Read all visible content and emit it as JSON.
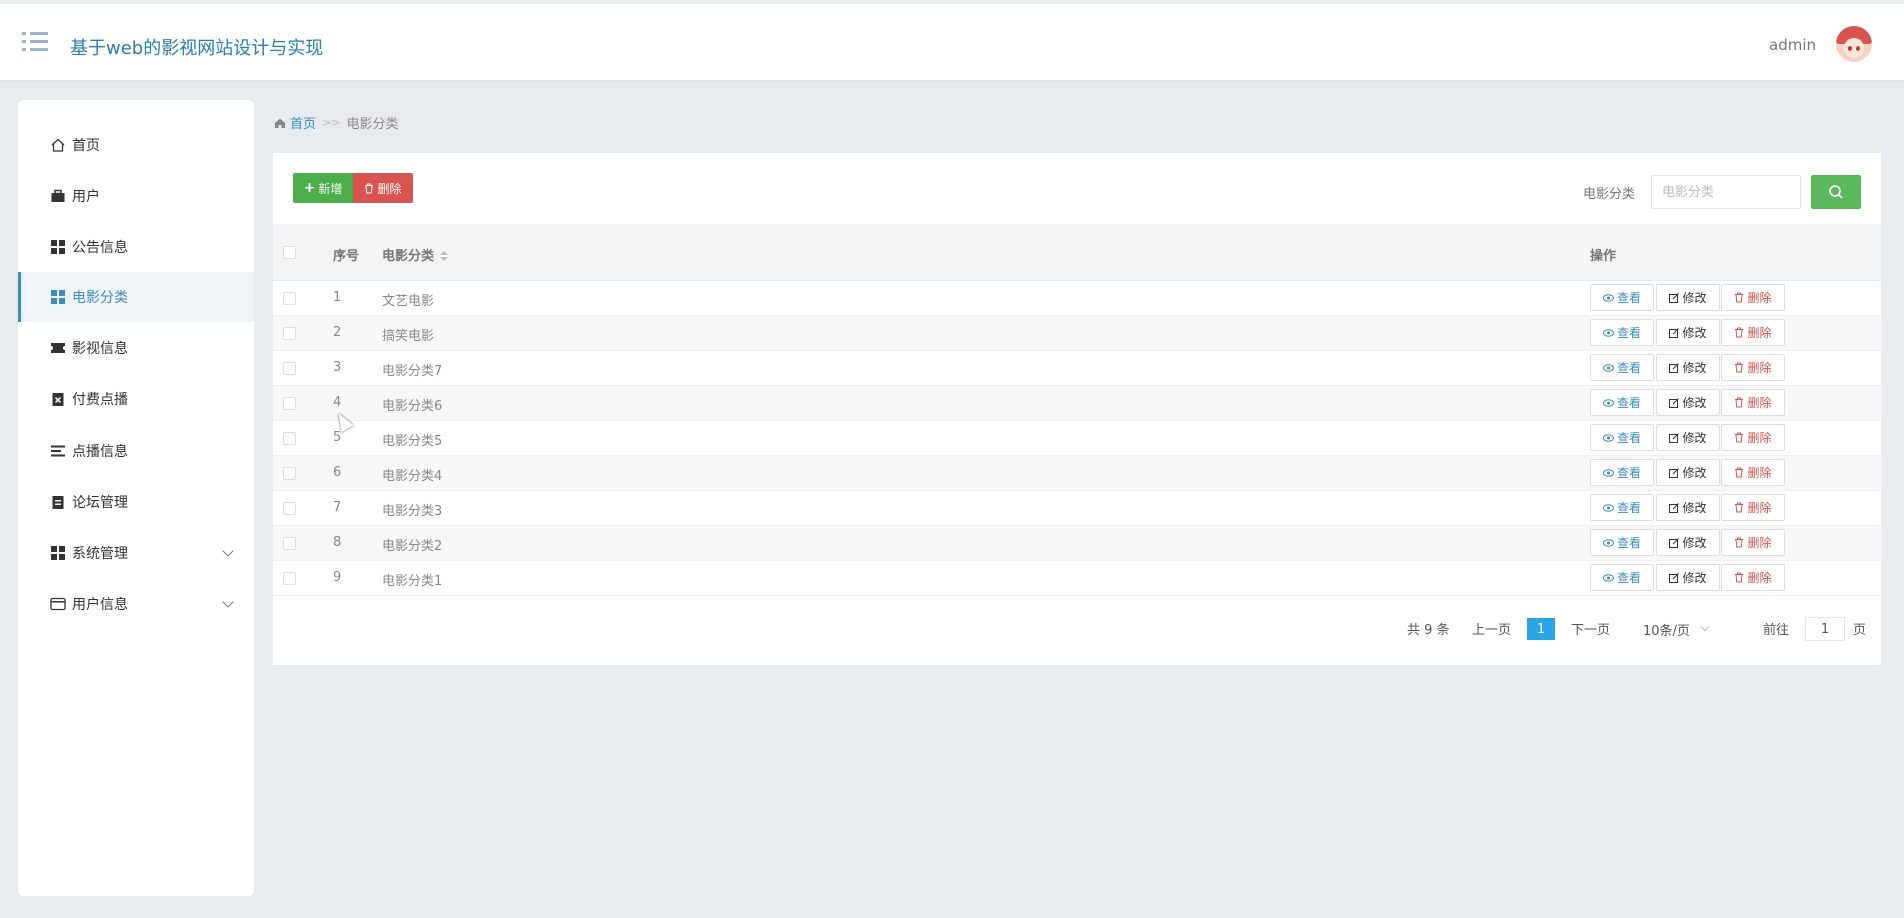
{
  "header": {
    "title": "基于web的影视网站设计与实现",
    "user": "admin"
  },
  "sidebar": {
    "items": [
      {
        "label": "首页",
        "icon": "home-icon"
      },
      {
        "label": "用户",
        "icon": "briefcase-icon"
      },
      {
        "label": "公告信息",
        "icon": "grid-icon"
      },
      {
        "label": "电影分类",
        "icon": "grid-icon",
        "active": true
      },
      {
        "label": "影视信息",
        "icon": "ticket-icon"
      },
      {
        "label": "付费点播",
        "icon": "clipboard-x-icon"
      },
      {
        "label": "点播信息",
        "icon": "list-icon"
      },
      {
        "label": "论坛管理",
        "icon": "clipboard-icon"
      },
      {
        "label": "系统管理",
        "icon": "grid-icon",
        "expandable": true
      },
      {
        "label": "用户信息",
        "icon": "card-icon",
        "expandable": true
      }
    ]
  },
  "breadcrumb": {
    "home": "首页",
    "sep": ">>",
    "current": "电影分类"
  },
  "toolbar": {
    "add_label": "新增",
    "delete_label": "删除",
    "search_label": "电影分类",
    "search_placeholder": "电影分类",
    "search_value": ""
  },
  "table": {
    "columns": {
      "index": "序号",
      "name": "电影分类",
      "actions": "操作"
    },
    "rows": [
      {
        "index": "1",
        "name": "文艺电影"
      },
      {
        "index": "2",
        "name": "搞笑电影"
      },
      {
        "index": "3",
        "name": "电影分类7"
      },
      {
        "index": "4",
        "name": "电影分类6"
      },
      {
        "index": "5",
        "name": "电影分类5"
      },
      {
        "index": "6",
        "name": "电影分类4"
      },
      {
        "index": "7",
        "name": "电影分类3"
      },
      {
        "index": "8",
        "name": "电影分类2"
      },
      {
        "index": "9",
        "name": "电影分类1"
      }
    ],
    "actions": {
      "view": "查看",
      "edit": "修改",
      "delete": "删除"
    }
  },
  "pagination": {
    "total": "共 9 条",
    "prev": "上一页",
    "current_page": "1",
    "next": "下一页",
    "page_size": "10条/页",
    "goto_label": "前往",
    "goto_value": "1",
    "page_suffix": "页"
  },
  "colors": {
    "accent": "#3c8dbc",
    "add": "#4cae4c",
    "delete": "#d9534f",
    "search": "#5cb85c",
    "page_active": "#29a6e4"
  }
}
